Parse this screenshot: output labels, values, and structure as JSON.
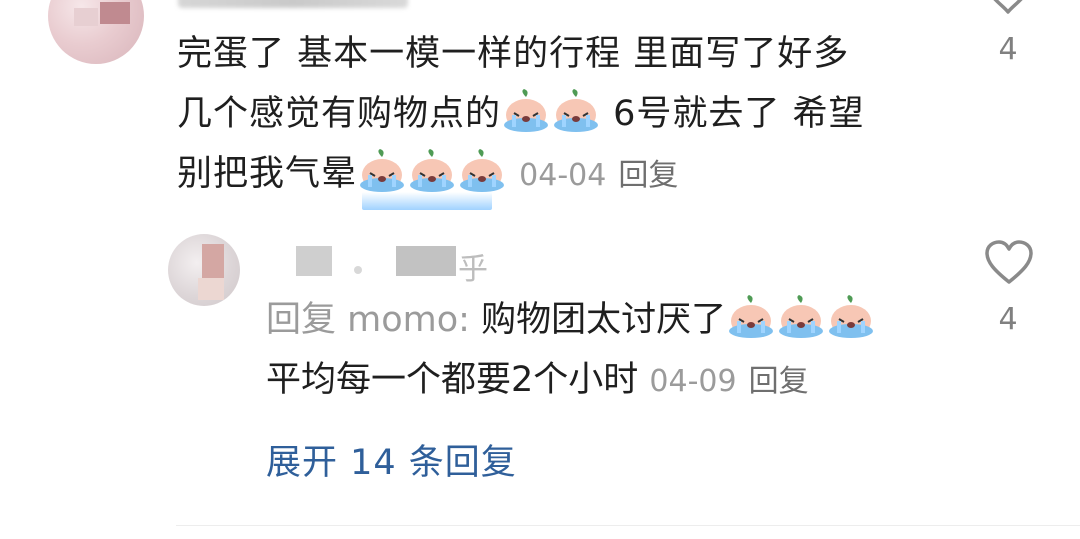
{
  "comment": {
    "line1": "完蛋了 基本一模一样的行程 里面写了好多",
    "line2_a": "几个感觉有购物点的",
    "line2_b": "6号就去了 希望",
    "line3_a": "别把我气晕",
    "date": "04-04",
    "reply_label": "回复",
    "like_count": "4",
    "emoji_name": "crying-peach-emoji"
  },
  "reply": {
    "prefix": "回复 momo: ",
    "text_a": "购物团太讨厌了",
    "line2": "平均每一个都要2个小时",
    "date": "04-09",
    "reply_label": "回复",
    "like_count": "4",
    "name_tail": "乎"
  },
  "expand": {
    "label": "展开 14 条回复"
  },
  "colors": {
    "text": "#1f1f1f",
    "meta": "#9b9b9b",
    "link": "#2f5f9a"
  }
}
